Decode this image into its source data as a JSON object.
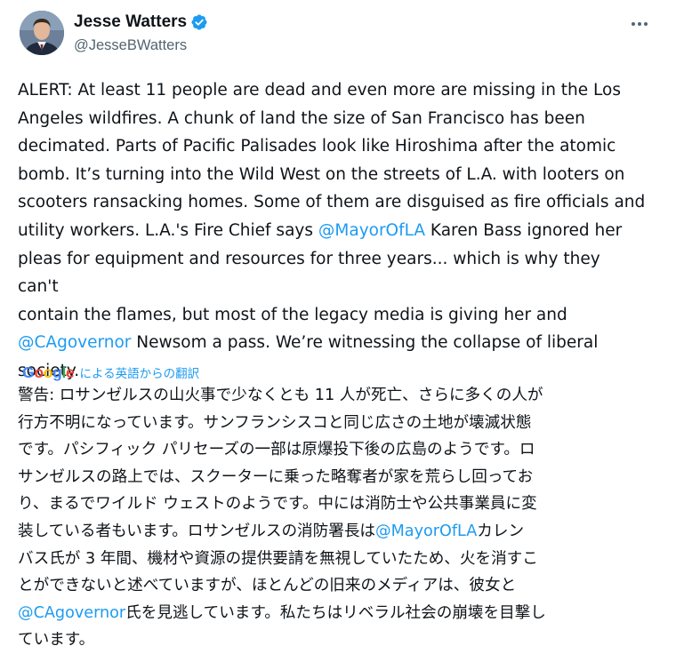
{
  "author": {
    "display_name": "Jesse Watters",
    "handle": "@JesseBWatters",
    "avatar_icon": "avatar-photo",
    "verified_icon": "verified-badge-icon"
  },
  "tweet": {
    "lines": [
      "ALERT: At least 11 people are dead and even more are missing in the Los",
      "Angeles wildfires. A chunk of land the size of San Francisco has been",
      "decimated. Parts of Pacific Palisades look like Hiroshima after the atomic",
      "bomb. It’s turning into the Wild West on the streets of L.A. with looters on",
      "scooters ransacking homes. Some of them are disguised as fire officials and"
    ],
    "line6_pre": "utility workers. L.A.'s Fire Chief says ",
    "mention_mayor": "@MayorOfLA",
    "line6_post": " Karen Bass ignored her",
    "line7": "pleas for equipment and resources for three years... which is why they can't",
    "line8": "contain the flames, but most of the legacy media is giving her and",
    "mention_governor": "@CAgovernor",
    "line9_post": " Newsom a pass. We’re witnessing the collapse of liberal",
    "line10": "society."
  },
  "translation_bar": {
    "google_letters": [
      "G",
      "o",
      "o",
      "g",
      "l",
      "e"
    ],
    "google_colors": [
      "#4285f4",
      "#ea4335",
      "#fbbc05",
      "#4285f4",
      "#34a853",
      "#ea4335"
    ],
    "label": "による英語からの翻訳"
  },
  "translation": {
    "lines": [
      "警告: ロサンゼルスの山火事で少なくとも 11 人が死亡、さらに多くの人が",
      "行方不明になっています。サンフランシスコと同じ広さの土地が壊滅状態",
      "です。パシフィック パリセーズの一部は原爆投下後の広島のようです。ロ",
      "サンゼルスの路上では、スクーターに乗った略奪者が家を荒らし回ってお",
      "り、まるでワイルド ウェストのようです。中には消防士や公共事業員に変"
    ],
    "line6_pre": "装している者もいます。ロサンゼルスの消防署長は",
    "mention_mayor": "@MayorOfLA",
    "line6_post": "カレン",
    "line7": "バス氏が 3 年間、機材や資源の提供要請を無視していたため、火を消すこ",
    "line8": "とができないと述べていますが、ほとんどの旧来のメディアは、彼女と",
    "mention_governor": "@CAgovernor",
    "line9_post": "氏を見逃しています。私たちはリベラル社会の崩壊を目撃し",
    "line10": "ています。"
  },
  "colors": {
    "link": "#1d9bf0",
    "text": "#0f1419",
    "secondary": "#536471"
  }
}
